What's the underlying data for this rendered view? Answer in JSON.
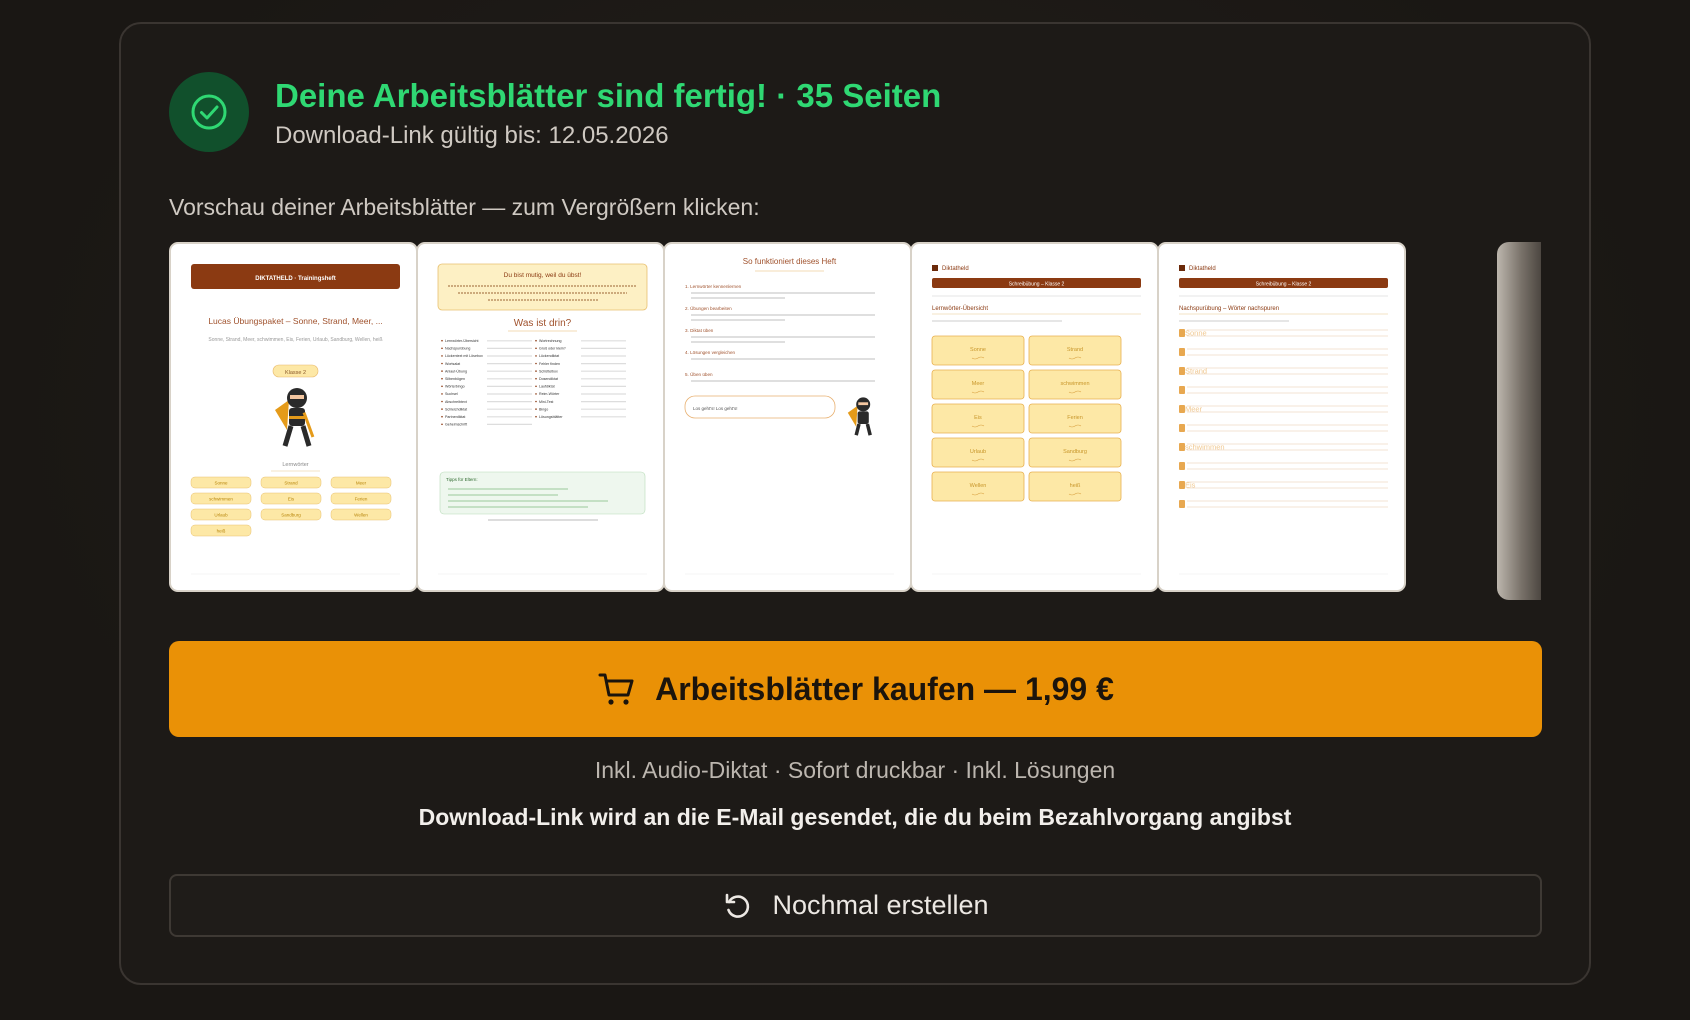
{
  "header": {
    "title": "Deine Arbeitsblätter sind fertig! · 35 Seiten",
    "subtitle": "Download-Link gültig bis: 12.05.2026"
  },
  "preview": {
    "label": "Vorschau deiner Arbeitsblätter — zum Vergrößern klicken:",
    "pages": [
      {
        "banner": "DIKTATHELD · Trainingsheft",
        "title": "Lucas Übungspaket – Sonne, Strand, Meer, ...",
        "words_line": "Sonne, Strand, Meer, schwimmen, Eis, Ferien, Urlaub, Sandburg, Wellen, heiß",
        "class_badge": "Klasse 2",
        "section": "Lernwörter",
        "word_chips": [
          "Sonne",
          "Strand",
          "Meer",
          "schwimmen",
          "Eis",
          "Ferien",
          "Urlaub",
          "Sandburg",
          "Wellen",
          "heiß"
        ]
      },
      {
        "box_title": "Du bist mutig, weil du übst!",
        "heading": "Was ist drin?",
        "col1": [
          "Lernwörter-Übersicht",
          "Nachspurübung",
          "Lückentext mit Lösebox",
          "Wortsalat",
          "Anlaut-Übung",
          "Silbenbögen",
          "Wörterbingo",
          "Suchsel",
          "Abschreibtext",
          "Schleichdiktat",
          "Partnerdiktat",
          "Geheimschrift"
        ],
        "col2": [
          "Wortrechnung",
          "Groß oder klein?",
          "Lückendiktat",
          "Fehler finden",
          "Schüttelbox",
          "Dosendiktat",
          "Laufdiktat",
          "Reim-Wörter",
          "Mini-Test",
          "Bingo",
          "Lösungsblätter"
        ],
        "tips_title": "Tipps für Eltern:"
      },
      {
        "heading": "So funktioniert dieses Heft",
        "steps": [
          "1. Lernwörter kennenlernen",
          "2. Übungen bearbeiten",
          "3. Diktat üben",
          "4. Lösungen vergleichen",
          "5. Üben üben"
        ],
        "speech": "Los geht's! Los geht's!"
      },
      {
        "brand": "Diktatheld",
        "banner": "Schreibübung – Klasse 2",
        "section": "Lernwörter-Übersicht",
        "word_cards": [
          "Sonne",
          "Strand",
          "Meer",
          "schwimmen",
          "Eis",
          "Ferien",
          "Urlaub",
          "Sandburg",
          "Wellen",
          "heiß"
        ]
      },
      {
        "brand": "Diktatheld",
        "banner": "Schreibübung – Klasse 2",
        "section": "Nachspurübung – Wörter nachspuren",
        "trace_words": [
          "Sonne",
          "",
          "Strand",
          "",
          "Meer",
          "",
          "schwimmen",
          "",
          "Eis",
          ""
        ]
      }
    ]
  },
  "buy": {
    "label": "Arbeitsblätter kaufen — 1,99 €"
  },
  "features": "Inkl. Audio-Diktat · Sofort druckbar · Inkl. Lösungen",
  "email_note": "Download-Link wird an die E-Mail gesendet, die du beim Bezahlvorgang angibst",
  "retry": {
    "label": "Nochmal erstellen"
  },
  "colors": {
    "success": "#2fd873",
    "accent_orange": "#ea9106",
    "banner_brown": "#8b3a12",
    "chip_yellow": "#fde8a6"
  },
  "icons": {
    "check": "check-icon",
    "cart": "cart-icon",
    "retry": "refresh-icon"
  }
}
